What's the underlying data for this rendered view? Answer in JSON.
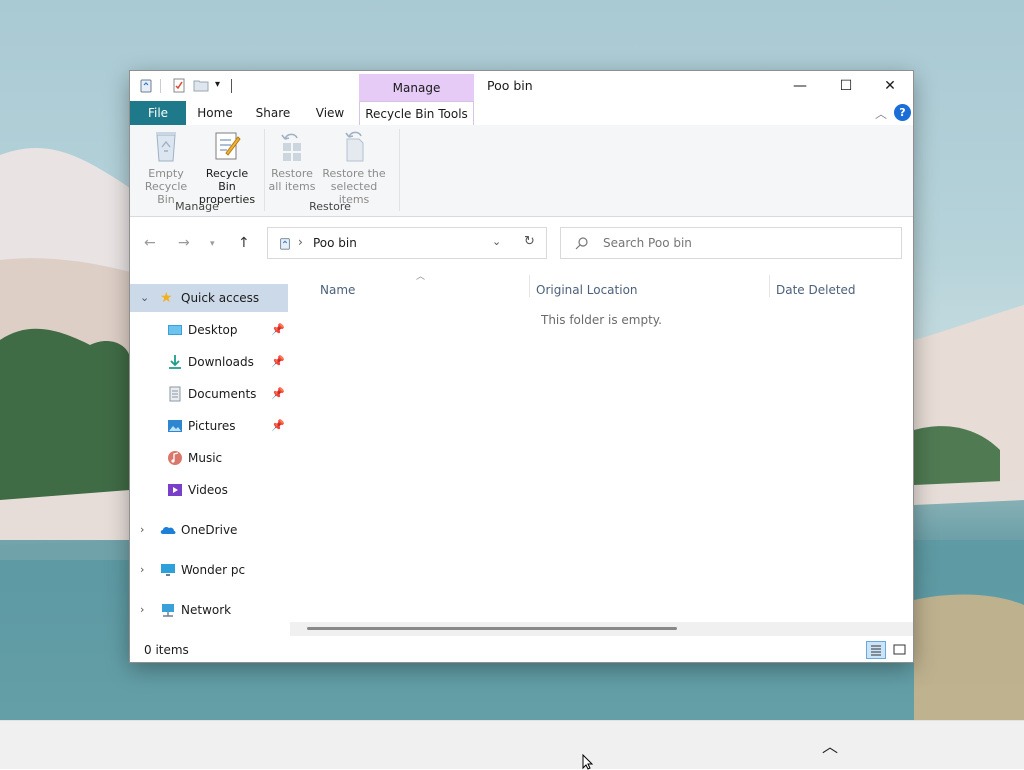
{
  "window": {
    "title": "Poo bin",
    "context_tab_header": "Manage",
    "minimize_glyph": "—",
    "maximize_glyph": "☐",
    "close_glyph": "✕"
  },
  "ribbon_tabs": {
    "file": "File",
    "home": "Home",
    "share": "Share",
    "view": "View",
    "tools": "Recycle Bin Tools",
    "help": "?"
  },
  "ribbon": {
    "empty_bin_line1": "Empty",
    "empty_bin_line2": "Recycle Bin",
    "properties_line1": "Recycle Bin",
    "properties_line2": "properties",
    "restore_all_line1": "Restore",
    "restore_all_line2": "all items",
    "restore_sel_line1": "Restore the",
    "restore_sel_line2": "selected items",
    "group_manage": "Manage",
    "group_restore": "Restore"
  },
  "navigation": {
    "breadcrumb": "Poo bin",
    "breadcrumb_sep": "›",
    "search_placeholder": "Search Poo bin"
  },
  "sidebar": {
    "quick_access": "Quick access",
    "items": [
      {
        "label": "Desktop",
        "icon": "desktop-icon",
        "pinned": true
      },
      {
        "label": "Downloads",
        "icon": "downloads-icon",
        "pinned": true
      },
      {
        "label": "Documents",
        "icon": "documents-icon",
        "pinned": true
      },
      {
        "label": "Pictures",
        "icon": "pictures-icon",
        "pinned": true
      },
      {
        "label": "Music",
        "icon": "music-icon",
        "pinned": false
      },
      {
        "label": "Videos",
        "icon": "videos-icon",
        "pinned": false
      }
    ],
    "onedrive": "OneDrive",
    "this_pc": "Wonder pc",
    "network": "Network"
  },
  "content": {
    "columns": [
      "Name",
      "Original Location",
      "Date Deleted"
    ],
    "empty_message": "This folder is empty."
  },
  "status": {
    "items": "0 items"
  },
  "colors": {
    "file_tab": "#1e7a8a",
    "context_tab": "#e5cbf6",
    "selection": "#ccd9e8",
    "help": "#1a6ed6"
  }
}
